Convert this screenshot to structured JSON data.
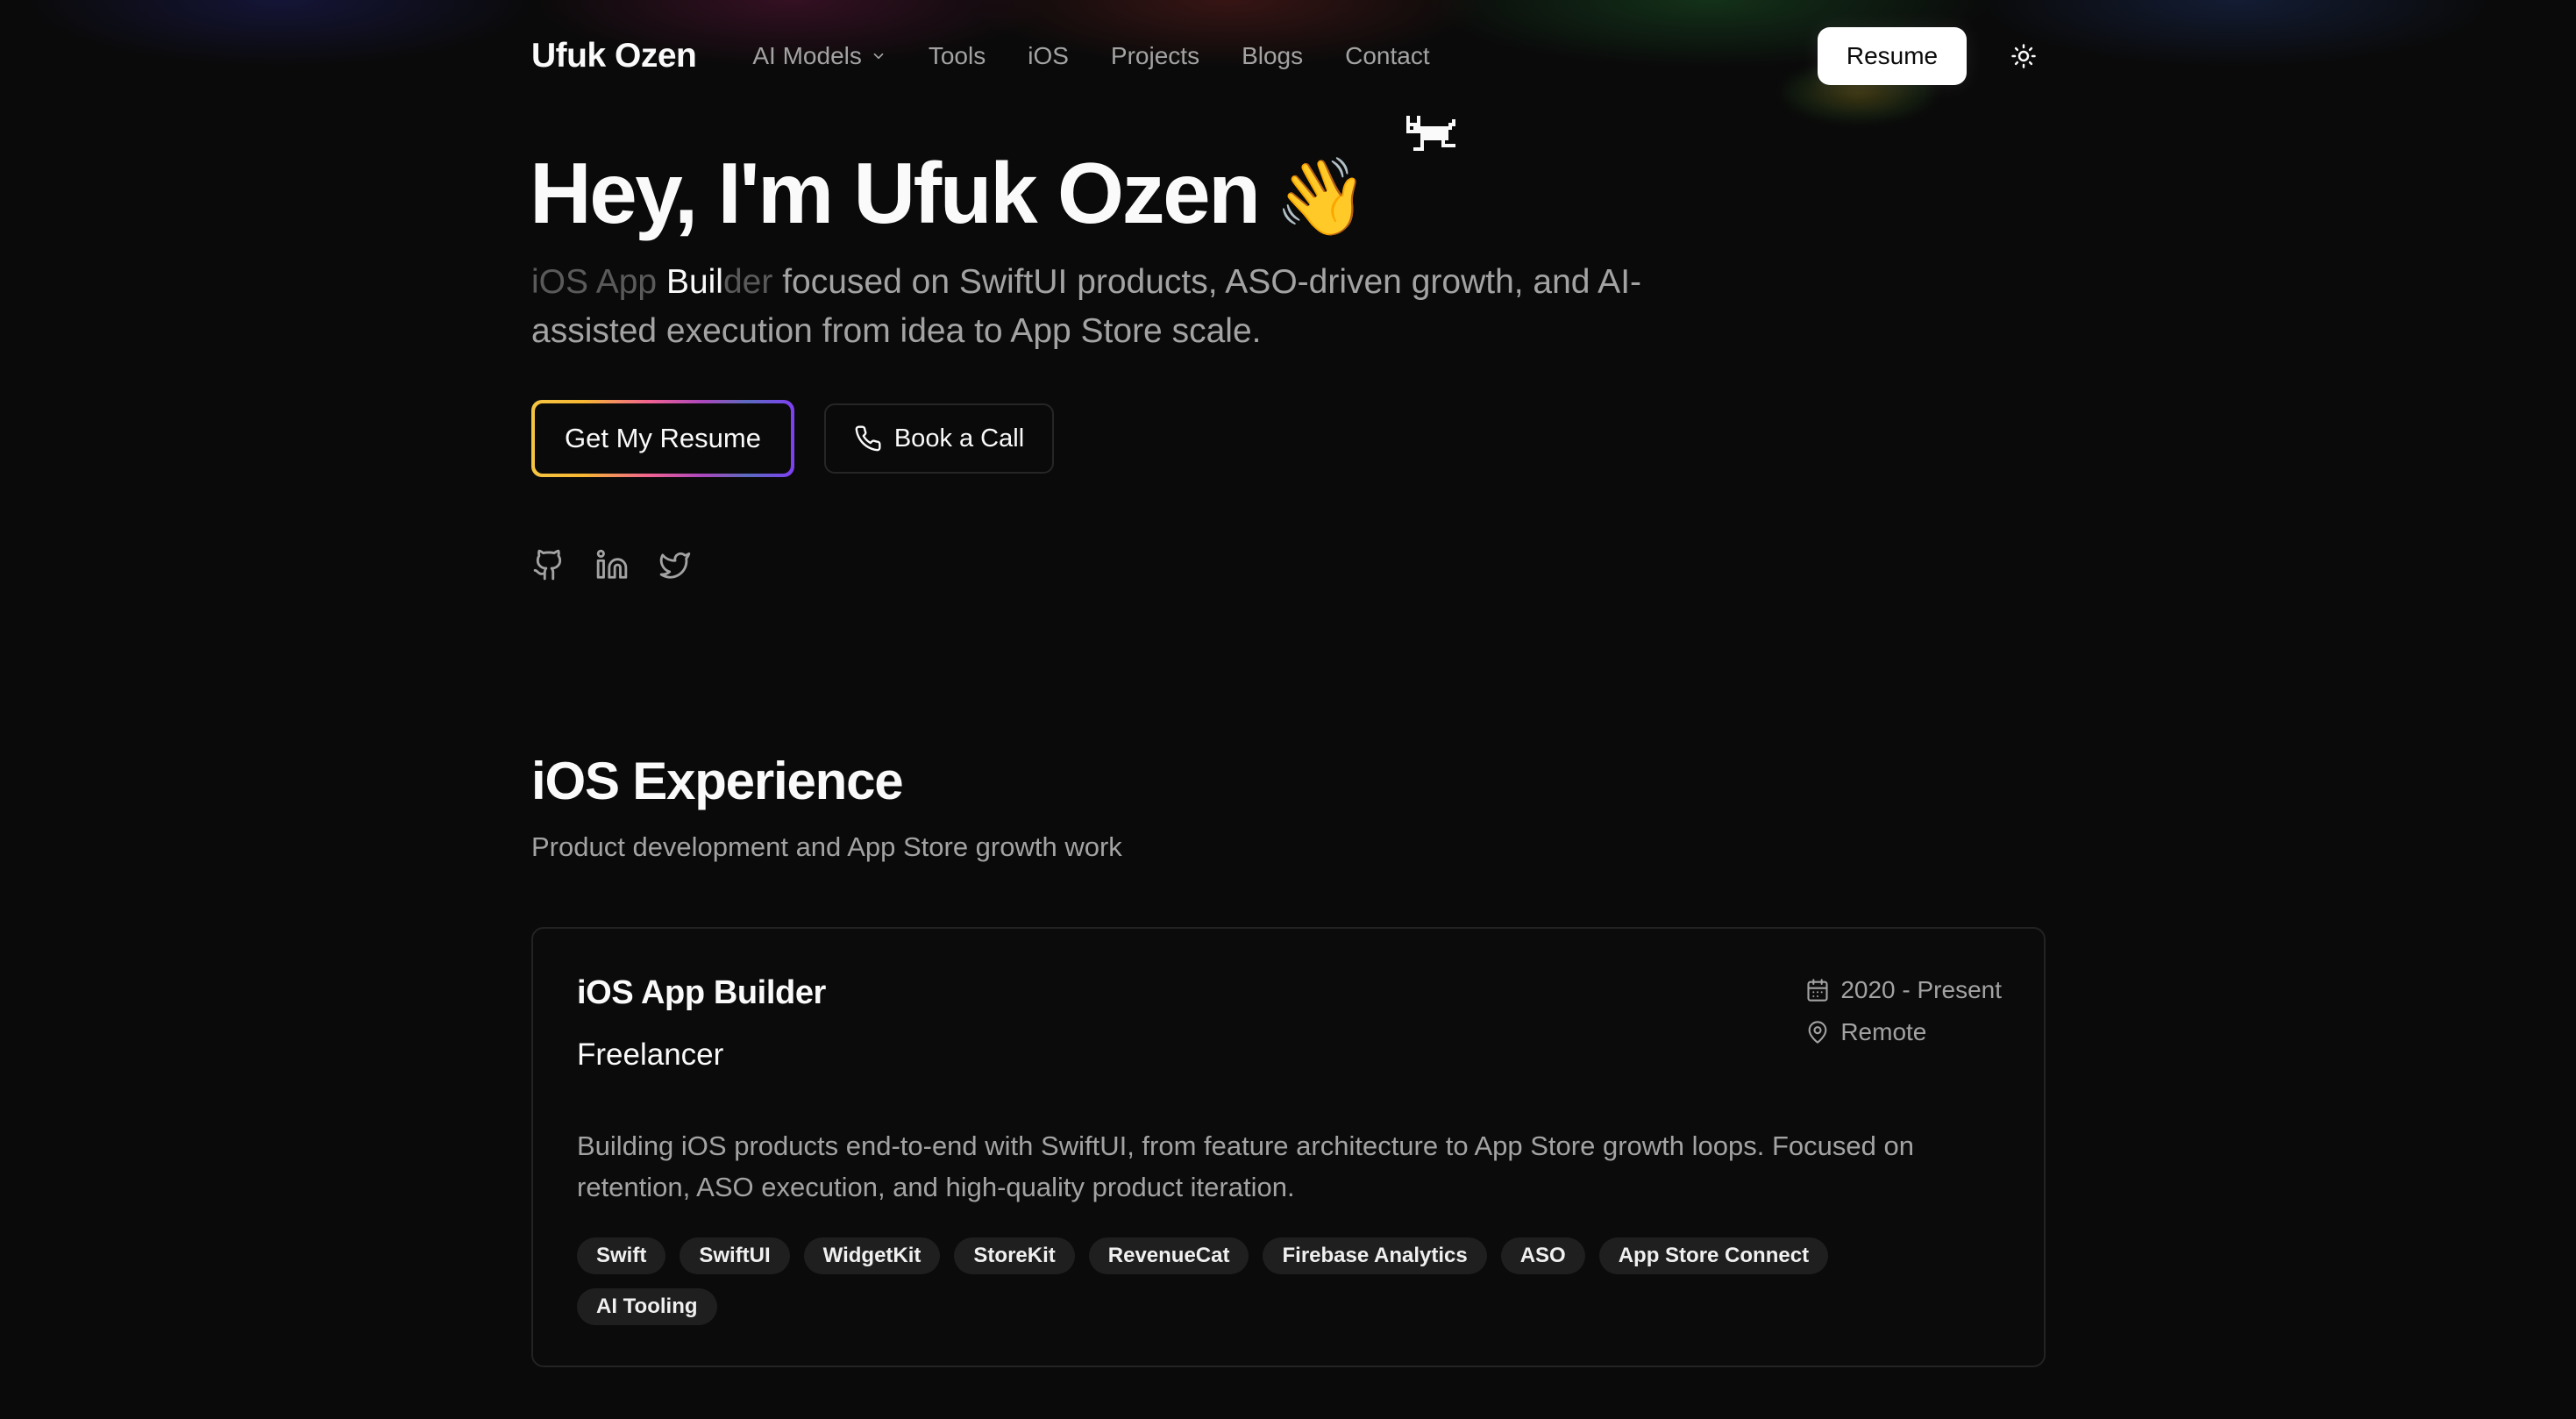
{
  "nav": {
    "brand": "Ufuk Ozen",
    "links": [
      "AI Models",
      "Tools",
      "iOS",
      "Projects",
      "Blogs",
      "Contact"
    ],
    "resume_label": "Resume"
  },
  "hero": {
    "title": "Hey, I'm Ufuk Ozen",
    "emoji": "👋",
    "subtitle_dim": "iOS App ",
    "subtitle_highlight": "Buil",
    "subtitle_dim2": "der",
    "subtitle_rest": " focused on SwiftUI products, ASO-driven growth, and AI-assisted execution from idea to App Store scale.",
    "primary_cta": "Get My Resume",
    "secondary_cta": "Book a Call"
  },
  "socials": [
    "github-icon",
    "linkedin-icon",
    "twitter-icon"
  ],
  "experience": {
    "title": "iOS Experience",
    "subtitle": "Product development and App Store growth work",
    "jobs": [
      {
        "role": "iOS App Builder",
        "company": "Freelancer",
        "period": "2020 - Present",
        "location": "Remote",
        "description": "Building iOS products end-to-end with SwiftUI, from feature architecture to App Store growth loops. Focused on retention, ASO execution, and high-quality product iteration.",
        "tags": [
          "Swift",
          "SwiftUI",
          "WidgetKit",
          "StoreKit",
          "RevenueCat",
          "Firebase Analytics",
          "ASO",
          "App Store Connect",
          "AI Tooling"
        ]
      }
    ]
  },
  "colors": {
    "background": "#0a0a0a",
    "text": "#fafafa",
    "muted": "#a3a3a3",
    "card_border": "#232323",
    "tag_bg": "#1f1f1f"
  }
}
